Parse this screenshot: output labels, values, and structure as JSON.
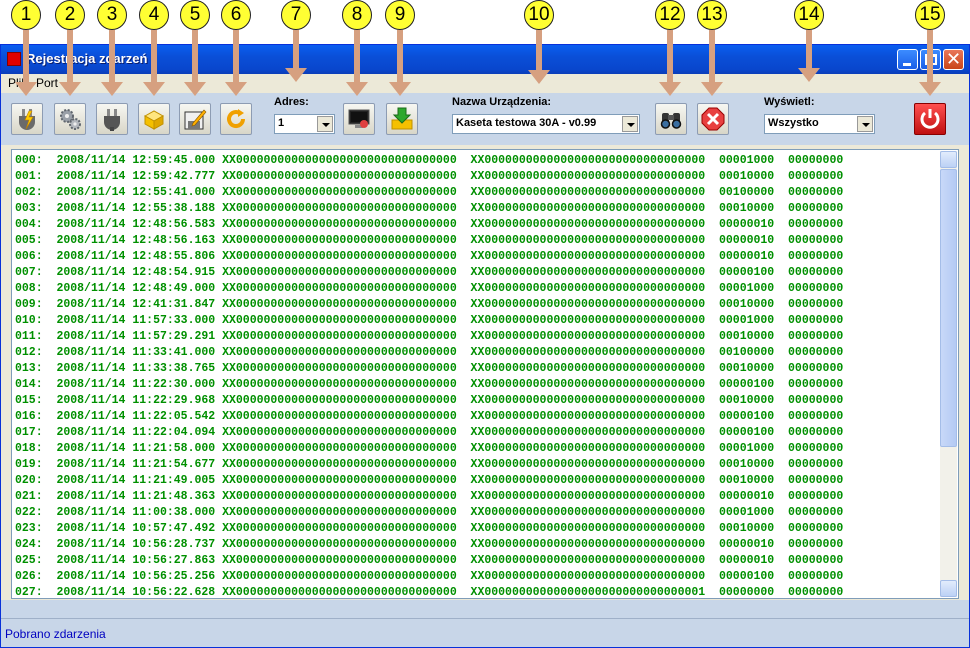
{
  "callouts": [
    "1",
    "2",
    "3",
    "4",
    "5",
    "6",
    "7",
    "8",
    "9",
    "10",
    "12",
    "13",
    "14",
    "15"
  ],
  "window": {
    "title": "Rejestracja zdarzeń"
  },
  "menu": [
    "Plik",
    "Port"
  ],
  "toolbar": {
    "address_label": "Adres:",
    "address_value": "1",
    "device_label": "Nazwa Urządzenia:",
    "device_value": "Kaseta testowa 30A - v0.99",
    "show_label": "Wyświetl:",
    "show_value": "Wszystko"
  },
  "icons": [
    "connect-icon",
    "settings-gears-icon",
    "disconnect-icon",
    "open-box-icon",
    "save-edit-icon",
    "refresh-icon",
    "monitor-icon",
    "download-box-icon",
    "binoculars-icon",
    "cancel-icon",
    "power-icon"
  ],
  "events": [
    {
      "n": "000",
      "date": "2008/11/14",
      "time": "12:59:45.000",
      "a": "XX00000000000000000000000000000000",
      "b": "XX00000000000000000000000000000000",
      "c": "00001000",
      "d": "00000000"
    },
    {
      "n": "001",
      "date": "2008/11/14",
      "time": "12:59:42.777",
      "a": "XX00000000000000000000000000000000",
      "b": "XX00000000000000000000000000000000",
      "c": "00010000",
      "d": "00000000"
    },
    {
      "n": "002",
      "date": "2008/11/14",
      "time": "12:55:41.000",
      "a": "XX00000000000000000000000000000000",
      "b": "XX00000000000000000000000000000000",
      "c": "00100000",
      "d": "00000000"
    },
    {
      "n": "003",
      "date": "2008/11/14",
      "time": "12:55:38.188",
      "a": "XX00000000000000000000000000000000",
      "b": "XX00000000000000000000000000000000",
      "c": "00010000",
      "d": "00000000"
    },
    {
      "n": "004",
      "date": "2008/11/14",
      "time": "12:48:56.583",
      "a": "XX00000000000000000000000000000000",
      "b": "XX00000000000000000000000000000000",
      "c": "00000010",
      "d": "00000000"
    },
    {
      "n": "005",
      "date": "2008/11/14",
      "time": "12:48:56.163",
      "a": "XX00000000000000000000000000000000",
      "b": "XX00000000000000000000000000000000",
      "c": "00000010",
      "d": "00000000"
    },
    {
      "n": "006",
      "date": "2008/11/14",
      "time": "12:48:55.806",
      "a": "XX00000000000000000000000000000000",
      "b": "XX00000000000000000000000000000000",
      "c": "00000010",
      "d": "00000000"
    },
    {
      "n": "007",
      "date": "2008/11/14",
      "time": "12:48:54.915",
      "a": "XX00000000000000000000000000000000",
      "b": "XX00000000000000000000000000000000",
      "c": "00000100",
      "d": "00000000"
    },
    {
      "n": "008",
      "date": "2008/11/14",
      "time": "12:48:49.000",
      "a": "XX00000000000000000000000000000000",
      "b": "XX00000000000000000000000000000000",
      "c": "00001000",
      "d": "00000000"
    },
    {
      "n": "009",
      "date": "2008/11/14",
      "time": "12:41:31.847",
      "a": "XX00000000000000000000000000000000",
      "b": "XX00000000000000000000000000000000",
      "c": "00010000",
      "d": "00000000"
    },
    {
      "n": "010",
      "date": "2008/11/14",
      "time": "11:57:33.000",
      "a": "XX00000000000000000000000000000000",
      "b": "XX00000000000000000000000000000000",
      "c": "00001000",
      "d": "00000000"
    },
    {
      "n": "011",
      "date": "2008/11/14",
      "time": "11:57:29.291",
      "a": "XX00000000000000000000000000000000",
      "b": "XX00000000000000000000000000000000",
      "c": "00010000",
      "d": "00000000"
    },
    {
      "n": "012",
      "date": "2008/11/14",
      "time": "11:33:41.000",
      "a": "XX00000000000000000000000000000000",
      "b": "XX00000000000000000000000000000000",
      "c": "00100000",
      "d": "00000000"
    },
    {
      "n": "013",
      "date": "2008/11/14",
      "time": "11:33:38.765",
      "a": "XX00000000000000000000000000000000",
      "b": "XX00000000000000000000000000000000",
      "c": "00010000",
      "d": "00000000"
    },
    {
      "n": "014",
      "date": "2008/11/14",
      "time": "11:22:30.000",
      "a": "XX00000000000000000000000000000000",
      "b": "XX00000000000000000000000000000000",
      "c": "00000100",
      "d": "00000000"
    },
    {
      "n": "015",
      "date": "2008/11/14",
      "time": "11:22:29.968",
      "a": "XX00000000000000000000000000000000",
      "b": "XX00000000000000000000000000000000",
      "c": "00010000",
      "d": "00000000"
    },
    {
      "n": "016",
      "date": "2008/11/14",
      "time": "11:22:05.542",
      "a": "XX00000000000000000000000000000000",
      "b": "XX00000000000000000000000000000000",
      "c": "00000100",
      "d": "00000000"
    },
    {
      "n": "017",
      "date": "2008/11/14",
      "time": "11:22:04.094",
      "a": "XX00000000000000000000000000000000",
      "b": "XX00000000000000000000000000000000",
      "c": "00000100",
      "d": "00000000"
    },
    {
      "n": "018",
      "date": "2008/11/14",
      "time": "11:21:58.000",
      "a": "XX00000000000000000000000000000000",
      "b": "XX00000000000000000000000000000000",
      "c": "00001000",
      "d": "00000000"
    },
    {
      "n": "019",
      "date": "2008/11/14",
      "time": "11:21:54.677",
      "a": "XX00000000000000000000000000000000",
      "b": "XX00000000000000000000000000000000",
      "c": "00010000",
      "d": "00000000"
    },
    {
      "n": "020",
      "date": "2008/11/14",
      "time": "11:21:49.005",
      "a": "XX00000000000000000000000000000000",
      "b": "XX00000000000000000000000000000000",
      "c": "00010000",
      "d": "00000000"
    },
    {
      "n": "021",
      "date": "2008/11/14",
      "time": "11:21:48.363",
      "a": "XX00000000000000000000000000000000",
      "b": "XX00000000000000000000000000000000",
      "c": "00000010",
      "d": "00000000"
    },
    {
      "n": "022",
      "date": "2008/11/14",
      "time": "11:00:38.000",
      "a": "XX00000000000000000000000000000000",
      "b": "XX00000000000000000000000000000000",
      "c": "00001000",
      "d": "00000000"
    },
    {
      "n": "023",
      "date": "2008/11/14",
      "time": "10:57:47.492",
      "a": "XX00000000000000000000000000000000",
      "b": "XX00000000000000000000000000000000",
      "c": "00010000",
      "d": "00000000"
    },
    {
      "n": "024",
      "date": "2008/11/14",
      "time": "10:56:28.737",
      "a": "XX00000000000000000000000000000000",
      "b": "XX00000000000000000000000000000000",
      "c": "00000010",
      "d": "00000000"
    },
    {
      "n": "025",
      "date": "2008/11/14",
      "time": "10:56:27.863",
      "a": "XX00000000000000000000000000000000",
      "b": "XX00000000000000000000000000000000",
      "c": "00000010",
      "d": "00000000"
    },
    {
      "n": "026",
      "date": "2008/11/14",
      "time": "10:56:25.256",
      "a": "XX00000000000000000000000000000000",
      "b": "XX00000000000000000000000000000000",
      "c": "00000100",
      "d": "00000000"
    },
    {
      "n": "027",
      "date": "2008/11/14",
      "time": "10:56:22.628",
      "a": "XX00000000000000000000000000000000",
      "b": "XX00000000000000000000000000000001",
      "c": "00000000",
      "d": "00000000"
    }
  ],
  "status": "Pobrano zdarzenia"
}
